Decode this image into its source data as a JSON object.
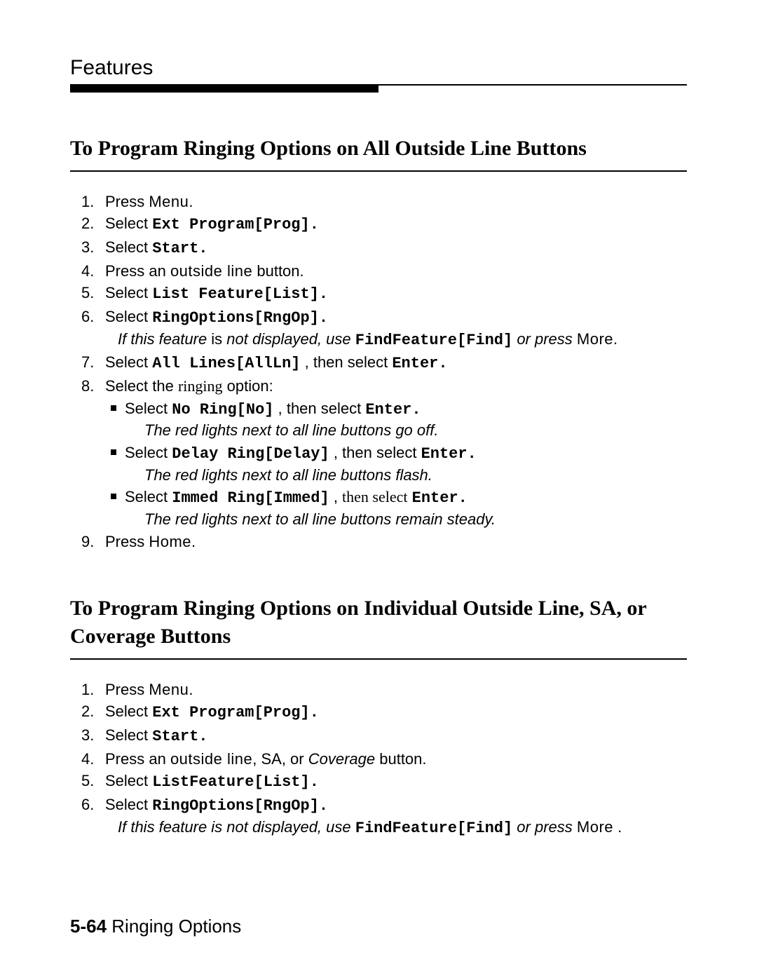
{
  "header": {
    "title": "Features"
  },
  "section1": {
    "title": "To Program Ringing Options on All Outside Line Buttons",
    "steps": {
      "s1_pre": "Press ",
      "s1_key": "Menu",
      "s1_post": ".",
      "s2_pre": "Select ",
      "s2_code": "Ext Program[Prog].",
      "s3_pre": "Select ",
      "s3_code": "Start.",
      "s4_pre": "Press an ",
      "s4_key": "outside line",
      "s4_post": " button.",
      "s5_pre": "Select ",
      "s5_code": "List Feature[List].",
      "s6_pre": "Select ",
      "s6_code": "RingOptions[RngOp].",
      "s6_note_a": "If this feature ",
      "s6_note_is": "is",
      "s6_note_b": " not displayed, use ",
      "s6_note_code": "FindFeature[Find]",
      "s6_note_c": " or press ",
      "s6_note_key": "More",
      "s6_note_d": ".",
      "s7_pre": "Select ",
      "s7_code": "All Lines[AllLn]",
      "s7_mid": " , then select ",
      "s7_code2": "Enter.",
      "s8_pre": "Select the ",
      "s8_word": "ringing",
      "s8_post": " option:",
      "sub1_pre": "Select ",
      "sub1_code": "No Ring[No]",
      "sub1_mid": " , then select ",
      "sub1_code2": "Enter.",
      "sub1_note": "The red lights next to all line buttons go off.",
      "sub2_pre": "Select ",
      "sub2_code": "Delay Ring[Delay]",
      "sub2_mid": " , then select ",
      "sub2_code2": "Enter.",
      "sub2_note": "The red lights next to all line buttons flash.",
      "sub3_pre": "Select ",
      "sub3_code": "Immed Ring[Immed]",
      "sub3_mid": " , ",
      "sub3_then": "then select",
      "sub3_sp": " ",
      "sub3_code2": "Enter.",
      "sub3_note": "The red lights next to all line buttons remain steady.",
      "s9_pre": "Press ",
      "s9_key": "Home",
      "s9_post": "."
    }
  },
  "section2": {
    "title": "To Program Ringing Options on Individual Outside Line, SA, or Coverage Buttons",
    "steps": {
      "s1_pre": "Press ",
      "s1_key": "Menu",
      "s1_post": ".",
      "s2_pre": "Select ",
      "s2_code": "Ext Program[Prog].",
      "s3_pre": "Select ",
      "s3_code": "Start.",
      "s4_pre": "Press an ",
      "s4_key": "outside line",
      "s4_mid": ", SA, or ",
      "s4_ital": "Coverage",
      "s4_post": " button.",
      "s5_pre": "Select ",
      "s5_code": "ListFeature[List].",
      "s6_pre": "Select ",
      "s6_code": "RingOptions[RngOp].",
      "s6_note_a": "If this feature is not displayed, use ",
      "s6_note_code": "FindFeature[Find]",
      "s6_note_c": " or press ",
      "s6_note_key": "More",
      "s6_note_d": " ."
    }
  },
  "footer": {
    "num": "5-64",
    "label": " Ringing Options"
  }
}
